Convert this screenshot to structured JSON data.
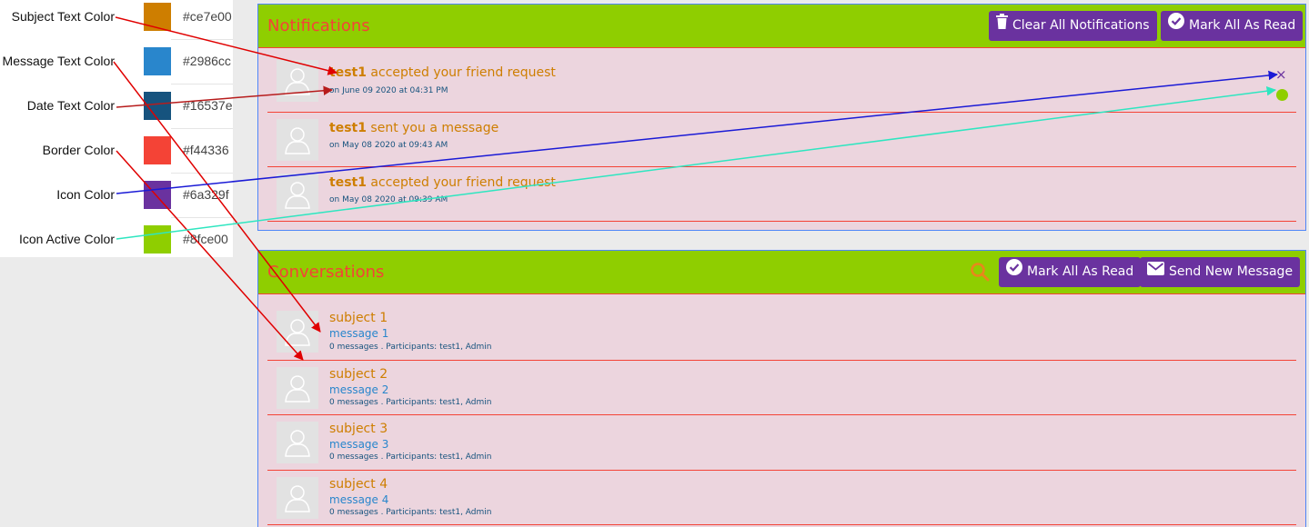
{
  "legend": [
    {
      "label": "Subject Text Color",
      "hex": "#ce7e00"
    },
    {
      "label": "Message Text Color",
      "hex": "#2986cc"
    },
    {
      "label": "Date Text Color",
      "hex": "#16537e"
    },
    {
      "label": "Border Color",
      "hex": "#f44336"
    },
    {
      "label": "Icon Color",
      "hex": "#6a329f"
    },
    {
      "label": "Icon Active Color",
      "hex": "#8fce00"
    }
  ],
  "notifications": {
    "title": "Notifications",
    "clear_all_label": "Clear All Notifications",
    "mark_all_read_label": "Mark All As Read",
    "items": [
      {
        "user": "test1",
        "text": " accepted your friend request",
        "date": "on June 09 2020 at 04:31 PM"
      },
      {
        "user": "test1",
        "text": " sent you a message",
        "date": "on May 08 2020 at 09:43 AM"
      },
      {
        "user": "test1",
        "text": " accepted your friend request",
        "date": "on May 08 2020 at 09:39 AM"
      }
    ]
  },
  "conversations": {
    "title": "Conversations",
    "mark_all_read_label": "Mark All As Read",
    "send_new_label": "Send New Message",
    "items": [
      {
        "subject": "subject 1",
        "message": "message 1",
        "meta": "0 messages . Participants: test1, Admin"
      },
      {
        "subject": "subject 2",
        "message": "message 2",
        "meta": "0 messages . Participants: test1, Admin"
      },
      {
        "subject": "subject 3",
        "message": "message 3",
        "meta": "0 messages . Participants: test1, Admin"
      },
      {
        "subject": "subject 4",
        "message": "message 4",
        "meta": "0 messages . Participants: test1, Admin"
      }
    ]
  },
  "icons": {
    "trash": "trash-icon",
    "check_circle": "check-circle-icon",
    "envelope": "envelope-icon",
    "search": "search-icon",
    "close": "close-icon",
    "user_avatar": "user-avatar-icon",
    "close_glyph": "×"
  },
  "colors": {
    "header_bg": "#8fce00",
    "panel_bg": "#ecd5de",
    "button_bg": "#6a329f",
    "title": "#f44336",
    "arrow_red": "#e00000",
    "arrow_darkred": "#b71c1c",
    "arrow_blue": "#1a1ad6",
    "arrow_teal": "#2ee6c0"
  }
}
